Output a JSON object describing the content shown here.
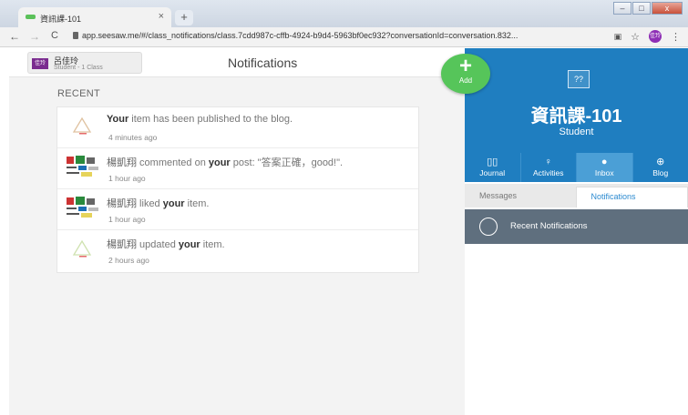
{
  "browser": {
    "tab_title": "資訊課-101",
    "tab_close": "×",
    "new_tab": "+",
    "url": "app.seesaw.me/#/class_notifications/class.7cdd987c-cffb-4924-b9d4-5963bf0ec932?conversationId=conversation.832...",
    "back": "←",
    "forward": "→",
    "reload": "C",
    "star": "☆",
    "menu": "⋮",
    "profile_initials": "佳玲"
  },
  "header": {
    "class_badge": "佳玲",
    "user_name": "呂佳玲",
    "user_sub": "Student - 1 Class",
    "page_title": "Notifications"
  },
  "notifications": {
    "section_label": "RECENT",
    "items": [
      {
        "actor": "Your",
        "text": " item has been published to the blog.",
        "time": "4 minutes ago"
      },
      {
        "actor": "楊凱翔",
        "pre": " commented on ",
        "bold": "your",
        "post": " post: \"答案正確，good!\".",
        "time": "1 hour ago"
      },
      {
        "actor": "楊凱翔",
        "pre": " liked ",
        "bold": "your",
        "post": " item.",
        "time": "1 hour ago"
      },
      {
        "actor": "楊凱翔",
        "pre": " updated ",
        "bold": "your",
        "post": " item.",
        "time": "2 hours ago"
      }
    ]
  },
  "fab": {
    "plus": "+",
    "label": "Add"
  },
  "panel": {
    "icon_glyph": "??",
    "class_title": "資訊課-101",
    "role": "Student",
    "tabs": [
      {
        "label": "Journal",
        "icon": "book-icon"
      },
      {
        "label": "Activities",
        "icon": "lightbulb-icon"
      },
      {
        "label": "Inbox",
        "icon": "chat-icon"
      },
      {
        "label": "Blog",
        "icon": "globe-icon"
      }
    ],
    "subtabs": [
      "Messages",
      "Notifications"
    ],
    "section_label": "Recent Notifications"
  },
  "colors": {
    "brand_blue": "#1f7ec0",
    "fab_green": "#56c55a",
    "section_gray": "#5f6f7e"
  }
}
